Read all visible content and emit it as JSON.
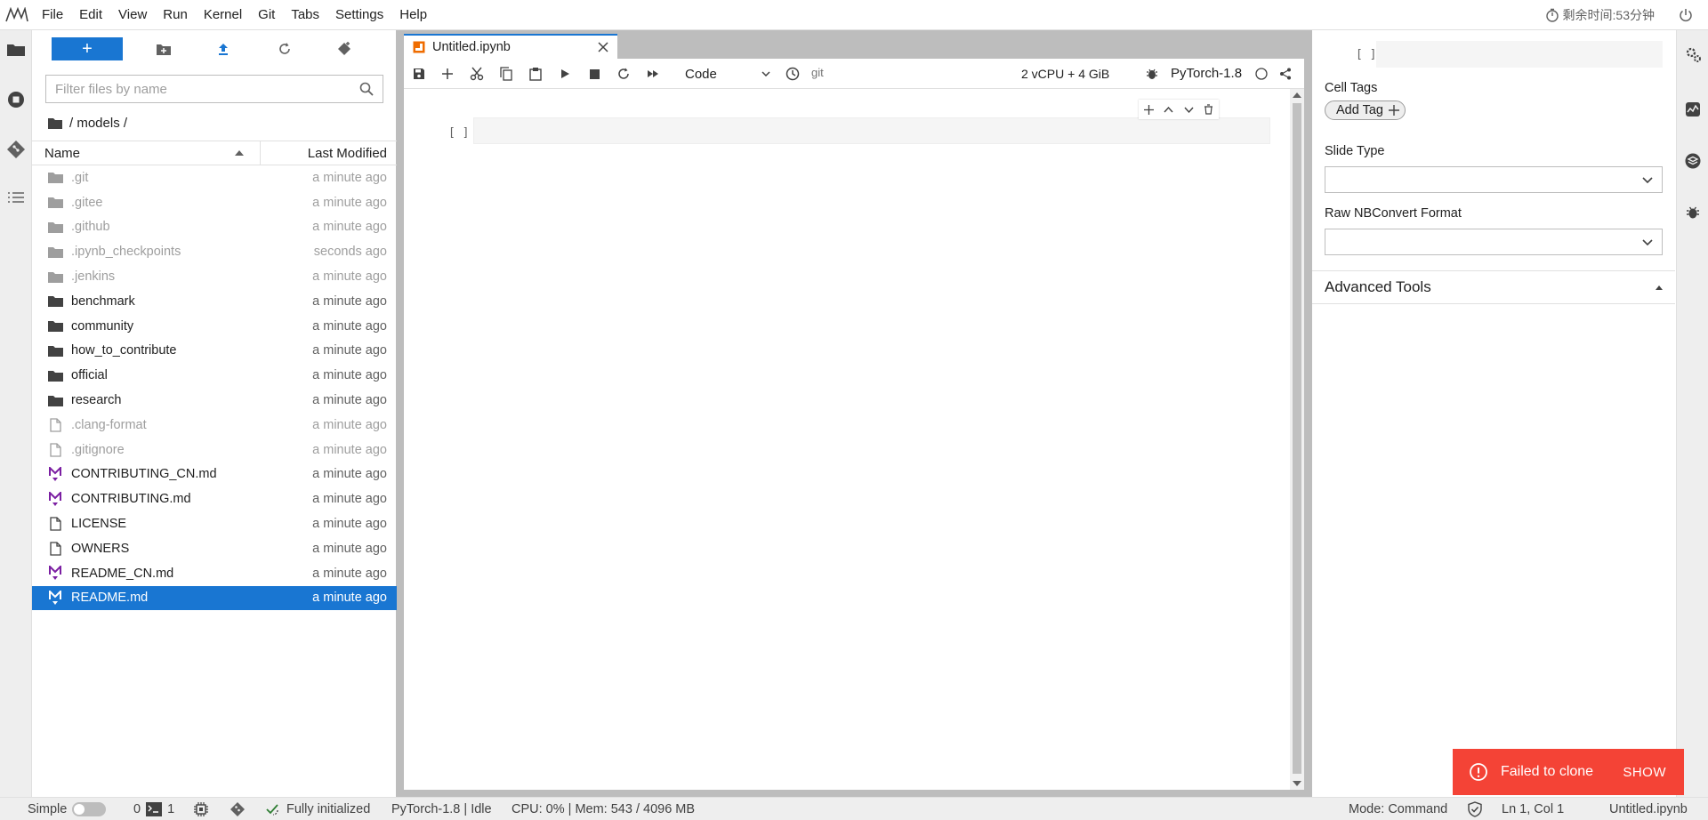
{
  "menubar": {
    "items": [
      "File",
      "Edit",
      "View",
      "Run",
      "Kernel",
      "Git",
      "Tabs",
      "Settings",
      "Help"
    ],
    "timer": "剩余时间:53分钟"
  },
  "filebrowser": {
    "new_label": "+",
    "filter_placeholder": "Filter files by name",
    "breadcrumb": "/ models /",
    "header_name": "Name",
    "header_modified": "Last Modified",
    "files": [
      {
        "name": ".git",
        "modified": "a minute ago",
        "kind": "folder",
        "hidden": true
      },
      {
        "name": ".gitee",
        "modified": "a minute ago",
        "kind": "folder",
        "hidden": true
      },
      {
        "name": ".github",
        "modified": "a minute ago",
        "kind": "folder",
        "hidden": true
      },
      {
        "name": ".ipynb_checkpoints",
        "modified": "seconds ago",
        "kind": "folder",
        "hidden": true
      },
      {
        "name": ".jenkins",
        "modified": "a minute ago",
        "kind": "folder",
        "hidden": true
      },
      {
        "name": "benchmark",
        "modified": "a minute ago",
        "kind": "folder",
        "hidden": false
      },
      {
        "name": "community",
        "modified": "a minute ago",
        "kind": "folder",
        "hidden": false
      },
      {
        "name": "how_to_contribute",
        "modified": "a minute ago",
        "kind": "folder",
        "hidden": false
      },
      {
        "name": "official",
        "modified": "a minute ago",
        "kind": "folder",
        "hidden": false
      },
      {
        "name": "research",
        "modified": "a minute ago",
        "kind": "folder",
        "hidden": false
      },
      {
        "name": ".clang-format",
        "modified": "a minute ago",
        "kind": "file",
        "hidden": true
      },
      {
        "name": ".gitignore",
        "modified": "a minute ago",
        "kind": "file",
        "hidden": true
      },
      {
        "name": "CONTRIBUTING_CN.md",
        "modified": "a minute ago",
        "kind": "markdown",
        "hidden": false
      },
      {
        "name": "CONTRIBUTING.md",
        "modified": "a minute ago",
        "kind": "markdown",
        "hidden": false
      },
      {
        "name": "LICENSE",
        "modified": "a minute ago",
        "kind": "file",
        "hidden": false
      },
      {
        "name": "OWNERS",
        "modified": "a minute ago",
        "kind": "file",
        "hidden": false
      },
      {
        "name": "README_CN.md",
        "modified": "a minute ago",
        "kind": "markdown",
        "hidden": false
      },
      {
        "name": "README.md",
        "modified": "a minute ago",
        "kind": "markdown",
        "hidden": false,
        "selected": true
      }
    ]
  },
  "notebook": {
    "tab_title": "Untitled.ipynb",
    "cell_type": "Code",
    "git_label": "git",
    "resources": "2 vCPU + 4 GiB",
    "kernel": "PyTorch-1.8",
    "cell_prompt": "[ ]"
  },
  "inspector": {
    "prompt": "[ ]",
    "cell_tags_label": "Cell Tags",
    "add_tag_label": "Add Tag",
    "slide_type_label": "Slide Type",
    "raw_format_label": "Raw NBConvert Format",
    "advanced_tools_label": "Advanced Tools"
  },
  "toast": {
    "message": "Failed to clone",
    "action": "SHOW"
  },
  "statusbar": {
    "mode_label": "Simple",
    "terminals_count": "0",
    "kernels_count": "1",
    "git_status": "Fully initialized",
    "kernel_status": "PyTorch-1.8 | Idle",
    "memory": "CPU: 0% | Mem: 543 / 4096 MB",
    "mode": "Mode: Command",
    "cursor": "Ln 1, Col 1",
    "filename": "Untitled.ipynb"
  },
  "colors": {
    "accent": "#1976d2",
    "toast": "#f44336",
    "markdown_icon": "#7b1fa2"
  }
}
